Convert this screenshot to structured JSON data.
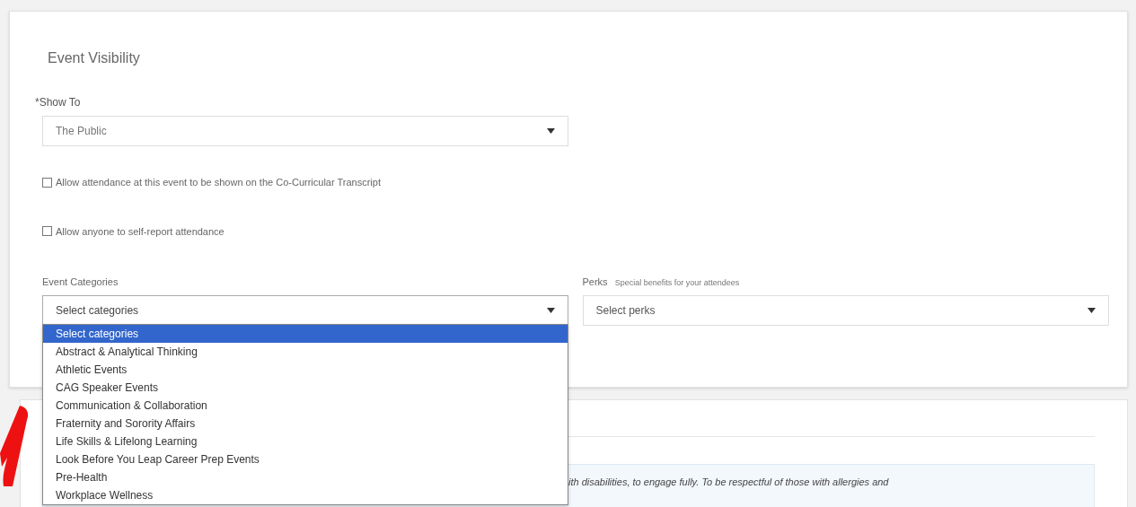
{
  "section": {
    "title": "Event Visibility"
  },
  "show_to": {
    "label": "*Show To",
    "value": "The Public"
  },
  "checkboxes": [
    {
      "label": "Allow attendance at this event to be shown on the Co-Curricular Transcript",
      "checked": false
    },
    {
      "label": "Allow anyone to self-report attendance",
      "checked": false
    }
  ],
  "categories": {
    "label": "Event Categories",
    "value": "Select categories",
    "expanded": true,
    "options": [
      {
        "label": "Select categories",
        "selected": true
      },
      {
        "label": "Abstract & Analytical Thinking",
        "selected": false
      },
      {
        "label": "Athletic Events",
        "selected": false
      },
      {
        "label": "CAG Speaker Events",
        "selected": false
      },
      {
        "label": "Communication & Collaboration",
        "selected": false
      },
      {
        "label": "Fraternity and Sorority Affairs",
        "selected": false
      },
      {
        "label": "Life Skills & Lifelong Learning",
        "selected": false
      },
      {
        "label": "Look Before You Leap Career Prep Events",
        "selected": false
      },
      {
        "label": "Pre-Health",
        "selected": false
      },
      {
        "label": "Workplace Wellness",
        "selected": false
      }
    ]
  },
  "perks": {
    "label": "Perks",
    "hint": "Special benefits for your attendees",
    "placeholder": "Select perks"
  },
  "notice": {
    "text": "ith disabilities, to engage fully. To be respectful of those with allergies and"
  }
}
